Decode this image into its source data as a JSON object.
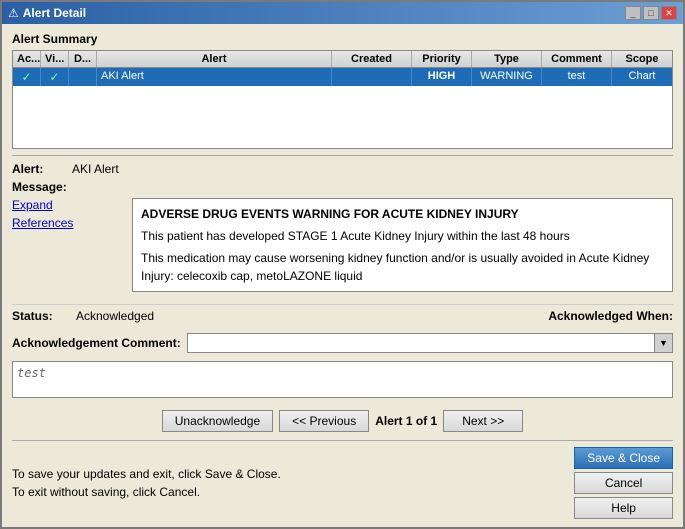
{
  "window": {
    "title": "Alert Detail"
  },
  "table": {
    "columns": [
      "Ac...",
      "Vi...",
      "D...",
      "Alert",
      "Created",
      "Priority",
      "Type",
      "Comment",
      "Scope"
    ],
    "rows": [
      {
        "acknowledged": true,
        "viewed": true,
        "d": "",
        "alert": "AKI Alert",
        "created": "",
        "priority": "HIGH",
        "type": "WARNING",
        "comment": "test",
        "scope": "Chart"
      }
    ]
  },
  "detail": {
    "label_alert": "Alert:",
    "alert_value": "AKI Alert",
    "label_message": "Message:",
    "message_line1": "ADVERSE DRUG EVENTS WARNING FOR ACUTE KIDNEY INJURY",
    "message_line2": "This patient has developed STAGE 1 Acute Kidney Injury within the last 48 hours",
    "message_line3": "This medication may cause worsening kidney function and/or is usually avoided in Acute Kidney Injury: celecoxib cap, metoLAZONE liquid",
    "expand_label": "Expand",
    "references_label": "References"
  },
  "status": {
    "label": "Status:",
    "value": "Acknowledged",
    "ack_when_label": "Acknowledged When:"
  },
  "ack_comment": {
    "label": "Acknowledgement Comment:",
    "placeholder": "",
    "textarea_value": "test"
  },
  "buttons": {
    "unacknowledge": "Unacknowledge",
    "previous": "<< Previous",
    "counter": "Alert 1 of 1",
    "next": "Next >>",
    "save_close": "Save & Close",
    "cancel": "Cancel",
    "help": "Help"
  },
  "footer": {
    "save_text": "To save your updates and exit, click Save & Close.",
    "cancel_text": "To exit without saving, click Cancel."
  }
}
